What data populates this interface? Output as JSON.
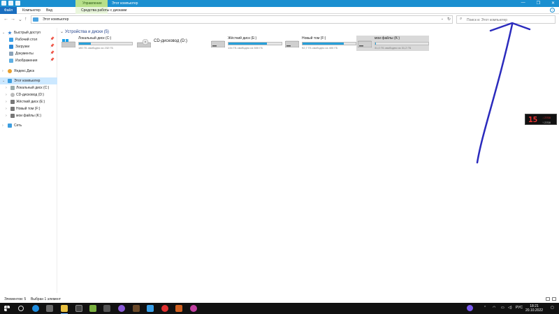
{
  "titlebar": {
    "context_tab": "Управление",
    "title": "Этот компьютер",
    "controls": [
      "—",
      "❐",
      "✕"
    ]
  },
  "ribbon": {
    "file_tab": "Файл",
    "tabs": [
      "Компьютер",
      "Вид"
    ],
    "tools_tab": "Средства работы с дисками",
    "help": "?"
  },
  "navigation": {
    "back": "←",
    "forward": "→",
    "recent": "⌄",
    "up": "↑",
    "address": "Этот компьютер",
    "address_dropdown": "⌄",
    "refresh": "↻",
    "search_placeholder": "Поиск в: Этот компьютер"
  },
  "sidebar": {
    "items": [
      {
        "label": "Быстрый доступ",
        "icon": "star-icon",
        "expanded": true
      },
      {
        "label": "Рабочий стол",
        "icon": "desktop-icon",
        "pinned": true
      },
      {
        "label": "Загрузки",
        "icon": "download-icon",
        "pinned": true
      },
      {
        "label": "Документы",
        "icon": "documents-icon",
        "pinned": true
      },
      {
        "label": "Изображения",
        "icon": "pictures-icon",
        "pinned": true
      },
      {
        "label": "Яндекс.Диск",
        "icon": "cloud-icon"
      },
      {
        "label": "Этот компьютер",
        "icon": "computer-icon",
        "selected": true
      },
      {
        "label": "Локальный диск (C:)",
        "icon": "drive-icon"
      },
      {
        "label": "CD-дисковод (D:)",
        "icon": "cd-drive-icon"
      },
      {
        "label": "Жёсткий диск (E:)",
        "icon": "drive-icon"
      },
      {
        "label": "Новый том (F:)",
        "icon": "drive-icon"
      },
      {
        "label": "мои файлы (K:)",
        "icon": "drive-icon"
      },
      {
        "label": "Сеть",
        "icon": "network-icon"
      }
    ]
  },
  "main": {
    "group_header": "Устройства и диски (5)",
    "drives": [
      {
        "name": "Локальный диск (C:)",
        "info": "180 ГБ свободно из 232 ГБ",
        "used": 0.22,
        "icon": "windows-drive-icon"
      },
      {
        "name": "CD-дисковод (D:)",
        "info": "",
        "used": null,
        "icon": "cd-drive-icon"
      },
      {
        "name": "Жёсткий диск (E:)",
        "info": "134 ГБ свободно из 500 ГБ",
        "used": 0.73,
        "icon": "drive-icon"
      },
      {
        "name": "Новый том (F:)",
        "info": "92,7 ГБ свободно из 400 ГБ",
        "used": 0.77,
        "icon": "drive-icon"
      },
      {
        "name": "мои файлы (K:)",
        "info": "31,0 ГБ свободно из 31,2 ГБ",
        "used": 0.01,
        "icon": "drive-icon",
        "selected": true
      }
    ]
  },
  "gadget": {
    "big": "15",
    "line1": "↓ 2700",
    "line2": "↑ 2700"
  },
  "statusbar": {
    "count": "Элементов: 5",
    "selected": "Выбран 1 элемент"
  },
  "taskbar": {
    "lang": "РУС",
    "time": "18:21",
    "date": "20.10.2022"
  },
  "colors": {
    "accent": "#1a8fd0",
    "usage_bar": "#26a0da",
    "annotation": "#2b2bbd"
  }
}
